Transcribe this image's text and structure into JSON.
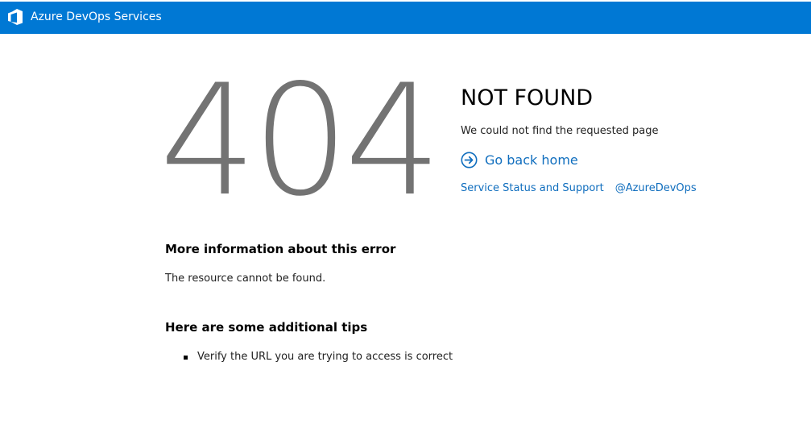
{
  "header": {
    "brand_name": "Azure DevOps Services",
    "logo_icon": "azure-devops-logo-icon",
    "background_color": "#0078d4"
  },
  "error": {
    "code": "404",
    "title": "NOT FOUND",
    "message": "We could not find the requested page",
    "go_home_label": "Go back home",
    "go_home_icon": "arrow-circle-right-icon",
    "link_color": "#106ebe",
    "code_color": "#737373"
  },
  "links": [
    {
      "label": "Service Status and Support"
    },
    {
      "label": "@AzureDevOps"
    }
  ],
  "more_info": {
    "heading": "More information about this error",
    "text": "The resource cannot be found."
  },
  "tips": {
    "heading": "Here are some additional tips",
    "items": [
      "Verify the URL you are trying to access is correct"
    ]
  }
}
